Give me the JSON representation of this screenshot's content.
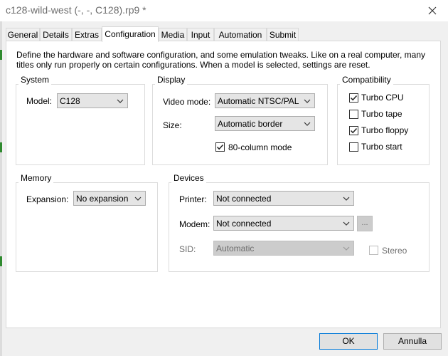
{
  "window": {
    "title": "c128-wild-west (-, -, C128).rp9 *"
  },
  "tabs": [
    {
      "label": "General"
    },
    {
      "label": "Details"
    },
    {
      "label": "Extras"
    },
    {
      "label": "Configuration"
    },
    {
      "label": "Media"
    },
    {
      "label": "Input"
    },
    {
      "label": "Automation"
    },
    {
      "label": "Submit"
    }
  ],
  "active_tab": "Configuration",
  "description": "Define the hardware and software configuration, and some emulation tweaks. Like on a real computer, many titles only run properly on certain configurations. When a model is selected, settings are reset.",
  "system": {
    "title": "System",
    "model_label": "Model:",
    "model_value": "C128"
  },
  "display": {
    "title": "Display",
    "video_mode_label": "Video mode:",
    "video_mode_value": "Automatic NTSC/PAL",
    "size_label": "Size:",
    "size_value": "Automatic border",
    "col80_label": "80-column mode",
    "col80_checked": true
  },
  "compatibility": {
    "title": "Compatibility",
    "items": [
      {
        "label": "Turbo CPU",
        "checked": true
      },
      {
        "label": "Turbo tape",
        "checked": false
      },
      {
        "label": "Turbo floppy",
        "checked": true
      },
      {
        "label": "Turbo start",
        "checked": false
      }
    ]
  },
  "memory": {
    "title": "Memory",
    "expansion_label": "Expansion:",
    "expansion_value": "No expansion"
  },
  "devices": {
    "title": "Devices",
    "printer_label": "Printer:",
    "printer_value": "Not connected",
    "modem_label": "Modem:",
    "modem_value": "Not connected",
    "modem_browse_label": "...",
    "sid_label": "SID:",
    "sid_value": "Automatic",
    "stereo_label": "Stereo",
    "stereo_checked": false
  },
  "buttons": {
    "ok": "OK",
    "cancel": "Annulla"
  }
}
